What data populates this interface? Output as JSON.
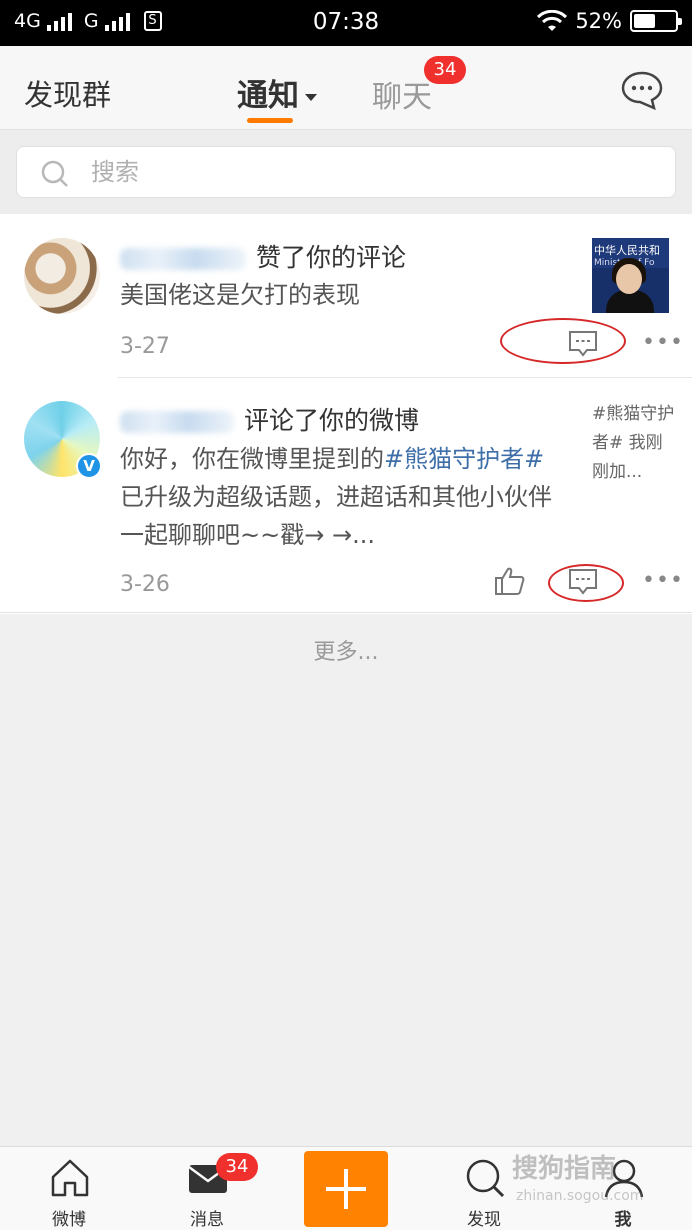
{
  "status_bar": {
    "network_left": "4G",
    "network_right": "G",
    "time": "07:38",
    "battery_text": "52%",
    "battery_level": 0.52
  },
  "top_nav": {
    "left_link": "发现群",
    "tab_notify": "通知",
    "tab_chat": "聊天",
    "chat_badge": "34",
    "icons": [
      "chat-bubble-icon"
    ]
  },
  "search": {
    "placeholder": "搜索"
  },
  "notifications": [
    {
      "action": "赞了你的评论",
      "body": "美国佬这是欠打的表现",
      "date": "3-27",
      "thumbnail_text_1": "中华人民共和",
      "thumbnail_text_2": "Ministry of Fo"
    },
    {
      "action": "评论了你的微博",
      "body_prefix": "你好，你在微博里提到的",
      "hashtag": "#熊猫守护者#",
      "body_suffix": "已升级为超级话题，进超话和其他小伙伴一起聊聊吧~~戳→ →...",
      "date": "3-26",
      "snippet": "#熊猫守护者# 我刚刚加...",
      "verified_mark": "V"
    }
  ],
  "load_more": "更多...",
  "more_dots": "•••",
  "tab_bar": {
    "home": "微博",
    "messages": "消息",
    "messages_badge": "34",
    "discover": "发现",
    "me": "我"
  },
  "colors": {
    "accent": "#ff8200",
    "badge": "#f0302c",
    "link": "#3f6fa8",
    "annotation": "#d62828"
  },
  "watermark": {
    "title": "搜狗指南",
    "url": "zhinan.sogou.com"
  }
}
